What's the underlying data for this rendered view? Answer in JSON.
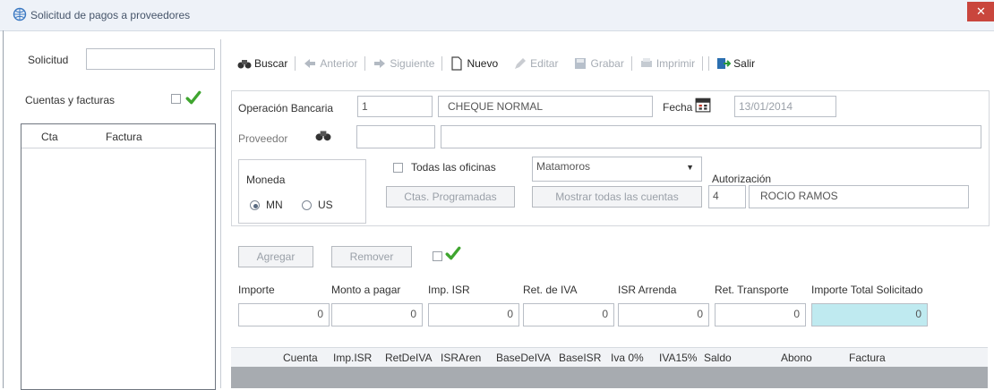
{
  "window": {
    "title": "Solicitud de pagos a proveedores"
  },
  "left_panel": {
    "solicitud_label": "Solicitud",
    "solicitud_value": "",
    "cuentas_label": "Cuentas y facturas",
    "list_headers": [
      "Cta",
      "Factura"
    ]
  },
  "toolbar": {
    "buscar": "Buscar",
    "anterior": "Anterior",
    "siguiente": "Siguiente",
    "nuevo": "Nuevo",
    "editar": "Editar",
    "grabar": "Grabar",
    "imprimir": "Imprimir",
    "salir": "Salir"
  },
  "form": {
    "operacion_label": "Operación Bancaria",
    "operacion_value": "1",
    "operacion_desc": "CHEQUE NORMAL",
    "fecha_label": "Fecha",
    "fecha_value": "13/01/2014",
    "proveedor_label": "Proveedor",
    "proveedor_code": "",
    "proveedor_name": "",
    "moneda_label": "Moneda",
    "moneda_mn": "MN",
    "moneda_us": "US",
    "todas_oficinas_label": "Todas las oficinas",
    "oficina_value": "Matamoros",
    "cles_programadas_button": "Ctas. Programadas",
    "mostrar_cuentas_button": "Mostrar todas las cuentas",
    "autorizacion_label": "Autorización",
    "autorizacion_code": "4",
    "autorizacion_name": "ROCIO RAMOS"
  },
  "actions": {
    "agregar": "Agregar",
    "remover": "Remover"
  },
  "amounts": {
    "labels": [
      "Importe",
      "Monto a pagar",
      "Imp. ISR",
      "Ret. de IVA",
      "ISR Arrenda",
      "Ret. Transporte",
      "Importe Total Solicitado"
    ],
    "values": [
      "0",
      "0",
      "0",
      "0",
      "0",
      "0",
      "0"
    ]
  },
  "grid": {
    "columns": [
      "Cuenta",
      "Imp.ISR",
      "RetDeIVA",
      "ISRAren",
      "BaseDeIVA",
      "BaseISR",
      "Iva 0%",
      "IVA15%",
      "Saldo",
      "Abono",
      "Factura"
    ]
  },
  "colors": {
    "accent_check": "#3fa52f",
    "total_highlight": "#bfeaf0",
    "close_button": "#c9463d"
  },
  "icons": {
    "window": "globe-icon",
    "buscar": "binoculars-icon",
    "anterior": "arrow-left-icon",
    "siguiente": "arrow-right-icon",
    "nuevo": "new-document-icon",
    "editar": "edit-icon",
    "grabar": "save-icon",
    "imprimir": "print-icon",
    "salir": "exit-icon",
    "fecha": "calendar-icon",
    "proveedor": "binoculars-icon",
    "check": "checkmark-icon"
  }
}
